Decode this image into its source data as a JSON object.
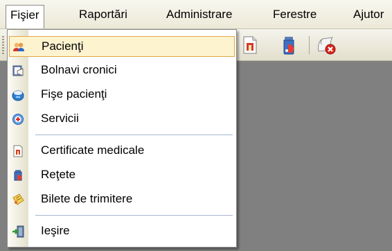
{
  "menubar": {
    "items": [
      {
        "label": "Fişier"
      },
      {
        "label": "Raportări"
      },
      {
        "label": "Administrare"
      },
      {
        "label": "Ferestre"
      },
      {
        "label": "Ajutor"
      }
    ]
  },
  "toolbar": {
    "buttons": [
      {
        "icon": "certificate-icon"
      },
      {
        "icon": "prescription-bottle-icon"
      },
      {
        "icon": "close-document-icon"
      }
    ]
  },
  "file_menu": {
    "items": [
      {
        "label": "Pacienţi",
        "icon": "patients-icon",
        "selected": true
      },
      {
        "label": "Bolnavi cronici",
        "icon": "chronic-patients-icon"
      },
      {
        "label": "Fişe pacienţi",
        "icon": "patient-files-icon"
      },
      {
        "label": "Servicii",
        "icon": "services-icon"
      },
      {
        "label": "Certificate medicale",
        "icon": "medical-certificate-icon"
      },
      {
        "label": "Reţete",
        "icon": "prescriptions-icon"
      },
      {
        "label": "Bilete de trimitere",
        "icon": "referral-tickets-icon"
      },
      {
        "label": "Ieşire",
        "icon": "exit-icon"
      }
    ]
  },
  "colors": {
    "highlight_fill": "#fdf3cf",
    "highlight_border": "#e0a646",
    "workspace": "#808080",
    "separator": "#a6b3cf"
  }
}
